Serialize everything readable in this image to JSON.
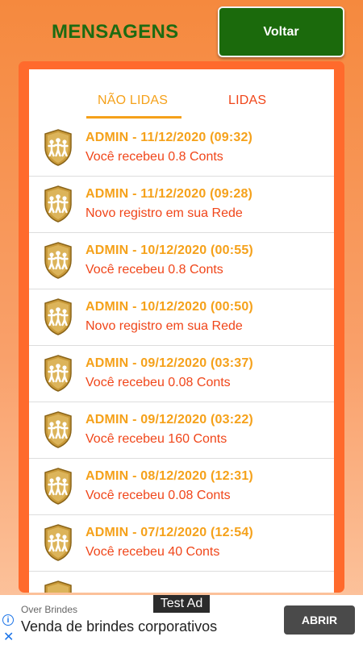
{
  "header": {
    "title": "MENSAGENS",
    "back_label": "Voltar"
  },
  "tabs": [
    {
      "label": "NÃO LIDAS",
      "active": true
    },
    {
      "label": "LIDAS",
      "active": false
    }
  ],
  "messages": [
    {
      "title": "ADMIN - 11/12/2020 (09:32)",
      "text": "Você recebeu 0.8 Conts",
      "icon": "shield-people-icon"
    },
    {
      "title": "ADMIN - 11/12/2020 (09:28)",
      "text": "Novo registro em sua Rede",
      "icon": "shield-people-icon"
    },
    {
      "title": "ADMIN - 10/12/2020 (00:55)",
      "text": "Você recebeu 0.8 Conts",
      "icon": "shield-people-icon"
    },
    {
      "title": "ADMIN - 10/12/2020 (00:50)",
      "text": "Novo registro em sua Rede",
      "icon": "shield-people-icon"
    },
    {
      "title": "ADMIN - 09/12/2020 (03:37)",
      "text": "Você recebeu 0.08 Conts",
      "icon": "shield-people-icon"
    },
    {
      "title": "ADMIN - 09/12/2020 (03:22)",
      "text": "Você recebeu 160 Conts",
      "icon": "shield-people-icon"
    },
    {
      "title": "ADMIN - 08/12/2020 (12:31)",
      "text": "Você recebeu 0.08 Conts",
      "icon": "shield-people-icon"
    },
    {
      "title": "ADMIN - 07/12/2020 (12:54)",
      "text": "Você recebeu 40 Conts",
      "icon": "shield-people-icon"
    }
  ],
  "ad": {
    "test_label": "Test Ad",
    "sponsor": "Over Brindes",
    "headline": "Venda de brindes corporativos",
    "open_label": "ABRIR"
  },
  "colors": {
    "accent_orange": "#f5a11a",
    "accent_red": "#f0461a",
    "panel_orange": "#ff6a2c",
    "title_green": "#1d6b12",
    "button_green": "#1b6a0c"
  }
}
